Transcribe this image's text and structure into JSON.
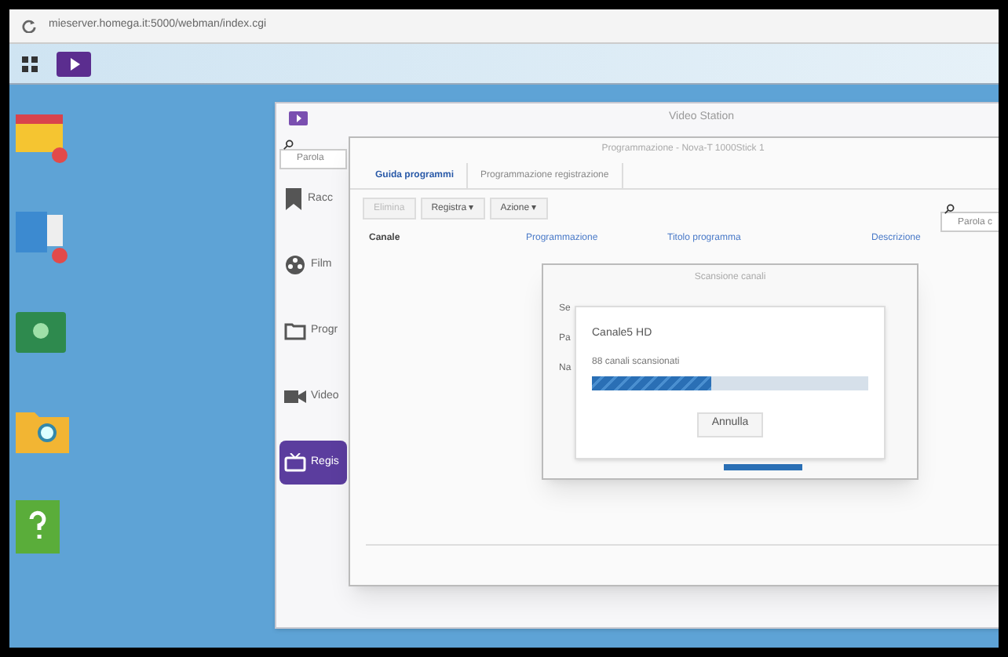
{
  "browser": {
    "url": "mieserver.homega.it:5000/webman/index.cgi"
  },
  "video_station": {
    "title": "Video Station",
    "search": {
      "placeholder": "Parola"
    },
    "sidebar": [
      {
        "label": "Racc",
        "kind": "collection",
        "selected": false
      },
      {
        "label": "Film",
        "kind": "film",
        "selected": false
      },
      {
        "label": "Progr",
        "kind": "folder",
        "selected": false
      },
      {
        "label": "Video",
        "kind": "camera",
        "selected": false
      },
      {
        "label": "Regis",
        "kind": "tv",
        "selected": true
      }
    ]
  },
  "schedule_window": {
    "title": "Programmazione - Nova-T 1000Stick 1",
    "tabs": [
      {
        "label": "Guida programmi",
        "selected": true
      },
      {
        "label": "Programmazione registrazione",
        "selected": false
      }
    ],
    "toolbar": [
      {
        "label": "Elimina",
        "disabled": true
      },
      {
        "label": "Registra ▾",
        "disabled": false
      },
      {
        "label": "Azione ▾",
        "disabled": false
      }
    ],
    "search": {
      "placeholder": "Parola c"
    },
    "columns": [
      "Canale",
      "Programmazione",
      "Titolo programma",
      "Descrizione"
    ]
  },
  "scan_dialog": {
    "title": "Scansione canali",
    "behind_labels": [
      "Se",
      "Pa",
      "Na"
    ],
    "progress": {
      "channel": "Canale5 HD",
      "count": "88 canali scansionati",
      "level": 0.43
    },
    "cancel_button": "Annulla"
  }
}
